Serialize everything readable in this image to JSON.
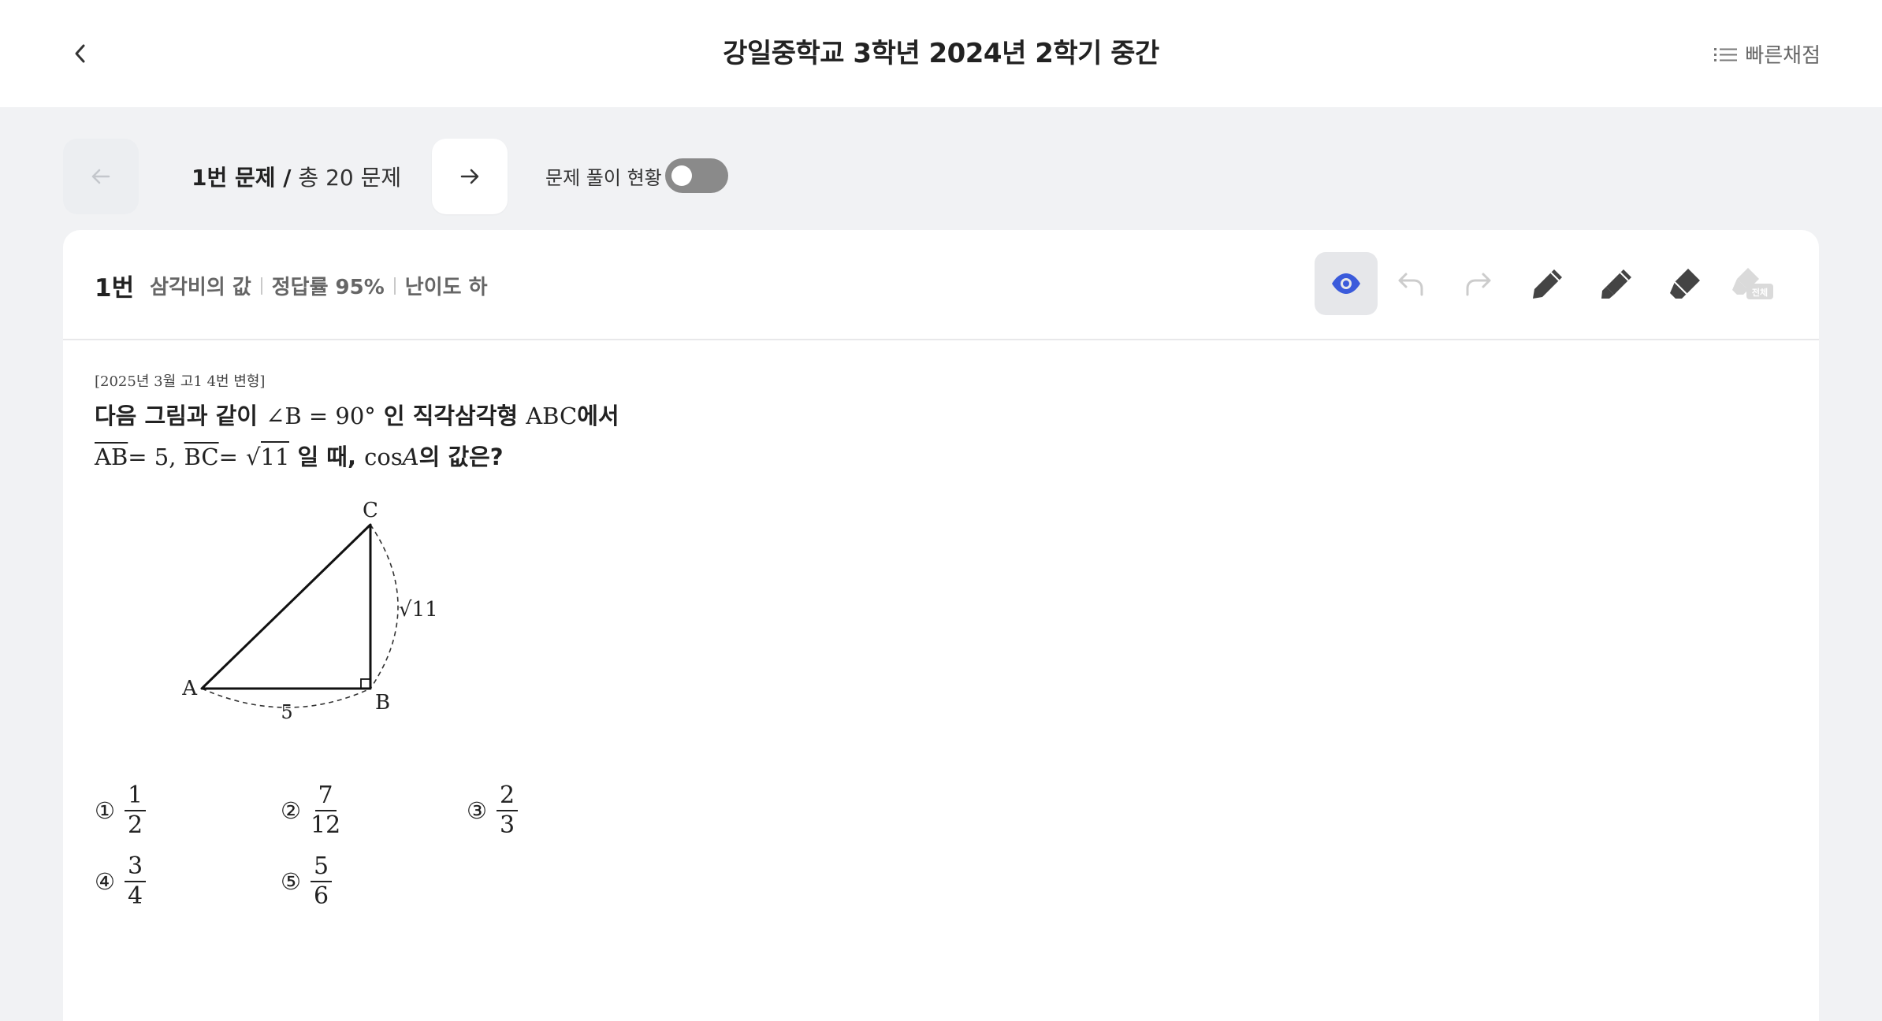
{
  "header": {
    "title": "강일중학교 3학년 2024년 2학기 중간",
    "quick_grade_label": "빠른채점"
  },
  "nav": {
    "current": "1번 문제 /",
    "total": "총 20 문제",
    "status_label": "문제 풀이 현황",
    "status_toggle_on": false
  },
  "question": {
    "number": "1번",
    "topic": "삼각비의 값",
    "accuracy": "정답률 95%",
    "difficulty": "난이도 하",
    "source": "[2025년 3월 고1 4번 변형]",
    "line1": {
      "pre": "다음 그림과 같이",
      "angle": "∠B = 90°",
      "mid": "인 직각삼각형",
      "tri": "ABC",
      "post": "에서"
    },
    "line2": {
      "ab": "AB",
      "ab_val": "= 5,",
      "bc": "BC",
      "bc_eq": "=",
      "sqrt_sym": "√",
      "sqrt_val": "11",
      "mid": "일 때,",
      "cos": "cos",
      "cos_var": "A",
      "post": "의 값은?"
    },
    "figure": {
      "label_a": "A",
      "label_b": "B",
      "label_c": "C",
      "side_ab": "5",
      "side_bc": "√11"
    },
    "choices": [
      {
        "num": "①",
        "numerator": "1",
        "denominator": "2"
      },
      {
        "num": "②",
        "numerator": "7",
        "denominator": "12"
      },
      {
        "num": "③",
        "numerator": "2",
        "denominator": "3"
      },
      {
        "num": "④",
        "numerator": "3",
        "denominator": "4"
      },
      {
        "num": "⑤",
        "numerator": "5",
        "denominator": "6"
      }
    ]
  },
  "toolbar": {
    "eraser_all_label": "전체"
  },
  "colors": {
    "accent": "#3b5bdb",
    "background": "#f1f2f4",
    "toggle_off": "#8a8a8a",
    "icon_dark": "#444444",
    "icon_light": "#cccccc"
  },
  "icons": [
    "chevron-left-icon",
    "list-icon",
    "arrow-left-icon",
    "arrow-right-icon",
    "eye-icon",
    "undo-icon",
    "redo-icon",
    "pen-icon",
    "highlighter-icon",
    "eraser-icon",
    "eraser-all-icon"
  ]
}
